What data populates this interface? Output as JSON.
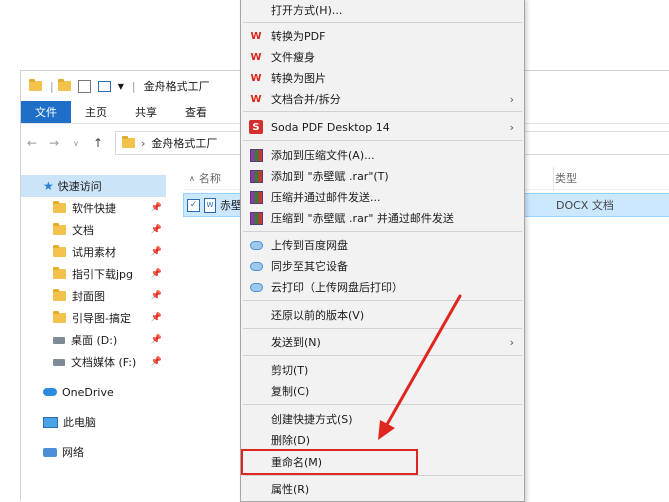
{
  "explorer": {
    "title": "金舟格式工厂",
    "ribbon_tabs": [
      "文件",
      "主页",
      "共享",
      "查看"
    ],
    "address": "金舟格式工厂",
    "column_name": "名称",
    "column_type": "类型",
    "file": {
      "name": "赤壁",
      "type": "DOCX 文档"
    },
    "sidebar": {
      "quick_access": "快速访问",
      "items": [
        "软件快捷",
        "文档",
        "试用素材",
        "指引下载jpg",
        "封面图",
        "引导图-搞定",
        "桌面 (D:)",
        "文档媒体 (F:)"
      ],
      "onedrive": "OneDrive",
      "this_pc": "此电脑",
      "network": "网络"
    }
  },
  "menu": {
    "open_with": "打开方式(H)...",
    "to_pdf": "转换为PDF",
    "slim": "文件瘦身",
    "to_image": "转换为图片",
    "merge_split": "文档合并/拆分",
    "soda": "Soda PDF Desktop 14",
    "add_archive": "添加到压缩文件(A)...",
    "add_rar": "添加到 \"赤壁赋 .rar\"(T)",
    "compress_email": "压缩并通过邮件发送...",
    "compress_rar_email": "压缩到 \"赤壁赋 .rar\" 并通过邮件发送",
    "upload_baidu": "上传到百度网盘",
    "sync_devices": "同步至其它设备",
    "cloud_print": "云打印（上传网盘后打印）",
    "restore": "还原以前的版本(V)",
    "send_to": "发送到(N)",
    "cut": "剪切(T)",
    "copy": "复制(C)",
    "shortcut": "创建快捷方式(S)",
    "delete": "删除(D)",
    "rename": "重命名(M)",
    "properties": "属性(R)"
  },
  "colors": {
    "accent": "#1e6fc8",
    "highlight": "#e0261e",
    "selection": "#cce8ff"
  }
}
